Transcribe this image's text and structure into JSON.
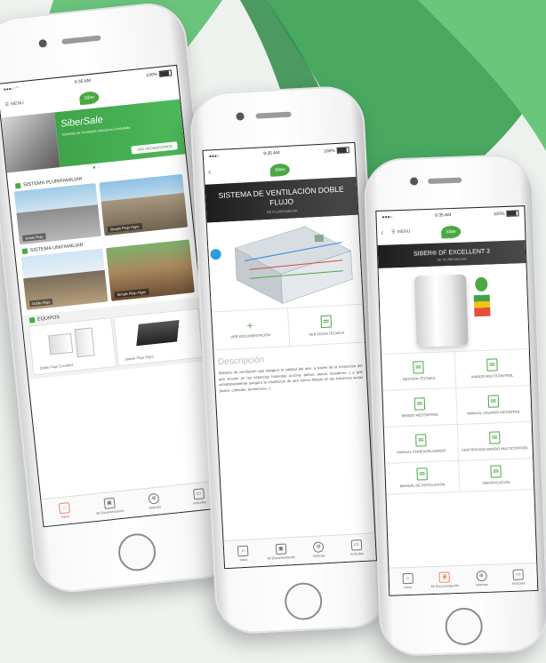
{
  "colors": {
    "brand_green": "#4aa843",
    "dark_banner": "#2b2b2b",
    "active_tab": "#e58a5e"
  },
  "status": {
    "time": "9:35 AM",
    "battery": "100%"
  },
  "phone1": {
    "menu_label": "MENU",
    "logo_text": "Siber",
    "hero_title": "SiberSale",
    "hero_sub": "Sistemas de Ventilación Mecánica Controlada",
    "hero_button": "VER PROMOCIONES",
    "sections": [
      {
        "title": "SISTEMA PLURIFAMILIAR",
        "cards": [
          "Doble Flujo",
          "Simple Flujo Higro"
        ]
      },
      {
        "title": "SISTEMA UNIFAMILIAR",
        "cards": [
          "Doble Flujo",
          "Simple Flujo Higro"
        ]
      },
      {
        "title": "EQUIPOS",
        "cards": [
          "Doble Flujo Excellent",
          "Simple Flujo Higro"
        ]
      }
    ]
  },
  "phone2": {
    "logo_text": "Siber",
    "title": "SISTEMA DE VENTILACIÓN DOBLE FLUJO",
    "subtitle": "DE PLURIFAMILIAR",
    "actions": [
      "VER DOCUMENTACIÓN",
      "VER FICHA TÉCNICA"
    ],
    "desc_heading": "Descripción",
    "desc_text": "Sistema de ventilación que asegura la calidad del aire, a través de la extracción del aire viciado en las estancias húmedas (cocina, baños, aseos, lavaderos...) y que simultáneamente asegura la insuflación de aire nuevo filtrado en las estancias secas (salón, comedor, dormitorios...)"
  },
  "phone3": {
    "menu_label": "MENU",
    "logo_text": "Siber",
    "title": "SIBER® DF EXCELLENT 3",
    "subtitle": "DE PLURIFAMILIAR",
    "docs": [
      "GESTIÓN TÉCNICA",
      "MANDO MULTICONTROL",
      "MANDO MECONTROL",
      "MANUAL USUARIO MCONTROL",
      "MANUAL CONEXIÓN MANDO",
      "CERTIFICADO MANDO MULTICONTROL",
      "MANUAL DE INSTALACIÓN",
      "CERTIFICACIÓN"
    ]
  },
  "tabbar": [
    {
      "icon": "home-icon",
      "label": "Inicio"
    },
    {
      "icon": "box-icon",
      "label": "Mi Documentación"
    },
    {
      "icon": "globe-icon",
      "label": "Noticias"
    },
    {
      "icon": "book-icon",
      "label": "Artículos"
    }
  ]
}
